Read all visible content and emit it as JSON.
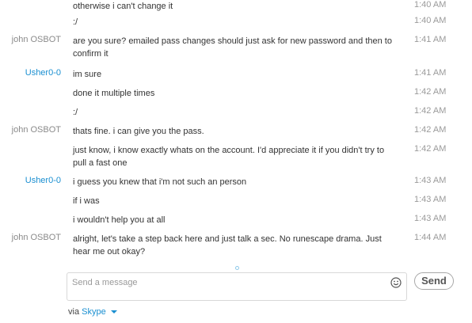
{
  "colors": {
    "accent": "#1a8fd1",
    "text": "#333333",
    "muted": "#8a8a8a",
    "border": "#d8d8d8"
  },
  "conversation": [
    {
      "sender": "",
      "self": false,
      "text": "otherwise i can't change it",
      "time": "1:40 AM"
    },
    {
      "sender": "",
      "self": false,
      "text": ":/",
      "time": "1:40 AM"
    },
    {
      "sender": "john OSBOT",
      "self": false,
      "text": "are you sure? emailed pass changes should just ask for new password and then to confirm it",
      "time": "1:41 AM"
    },
    {
      "sender": "Usher0-0",
      "self": true,
      "text": "im sure",
      "time": "1:41 AM"
    },
    {
      "sender": "",
      "self": false,
      "text": "done it multiple times",
      "time": "1:42 AM"
    },
    {
      "sender": "",
      "self": false,
      "text": ":/",
      "time": "1:42 AM"
    },
    {
      "sender": "john OSBOT",
      "self": false,
      "text": "thats fine. i can give you the pass.",
      "time": "1:42 AM"
    },
    {
      "sender": "",
      "self": false,
      "text": "just know, i know exactly whats on the account. I'd appreciate it if you didn't try to pull a fast one",
      "time": "1:42 AM"
    },
    {
      "sender": "Usher0-0",
      "self": true,
      "text": "i guess you knew that i'm not such an person",
      "time": "1:43 AM"
    },
    {
      "sender": "",
      "self": false,
      "text": "if i was",
      "time": "1:43 AM"
    },
    {
      "sender": "",
      "self": false,
      "text": "i wouldn't help you at all",
      "time": "1:43 AM"
    },
    {
      "sender": "john OSBOT",
      "self": false,
      "text": "alright, let's take a step back here and just talk a sec. No runescape drama. Just hear me out okay?",
      "time": "1:44 AM"
    }
  ],
  "composer": {
    "placeholder": "Send a message",
    "value": "",
    "emoticon_icon": "smiley-icon",
    "send_label": "Send"
  },
  "footer": {
    "via_label": "via",
    "service_label": "Skype",
    "dropdown_icon": "caret-down-icon"
  }
}
